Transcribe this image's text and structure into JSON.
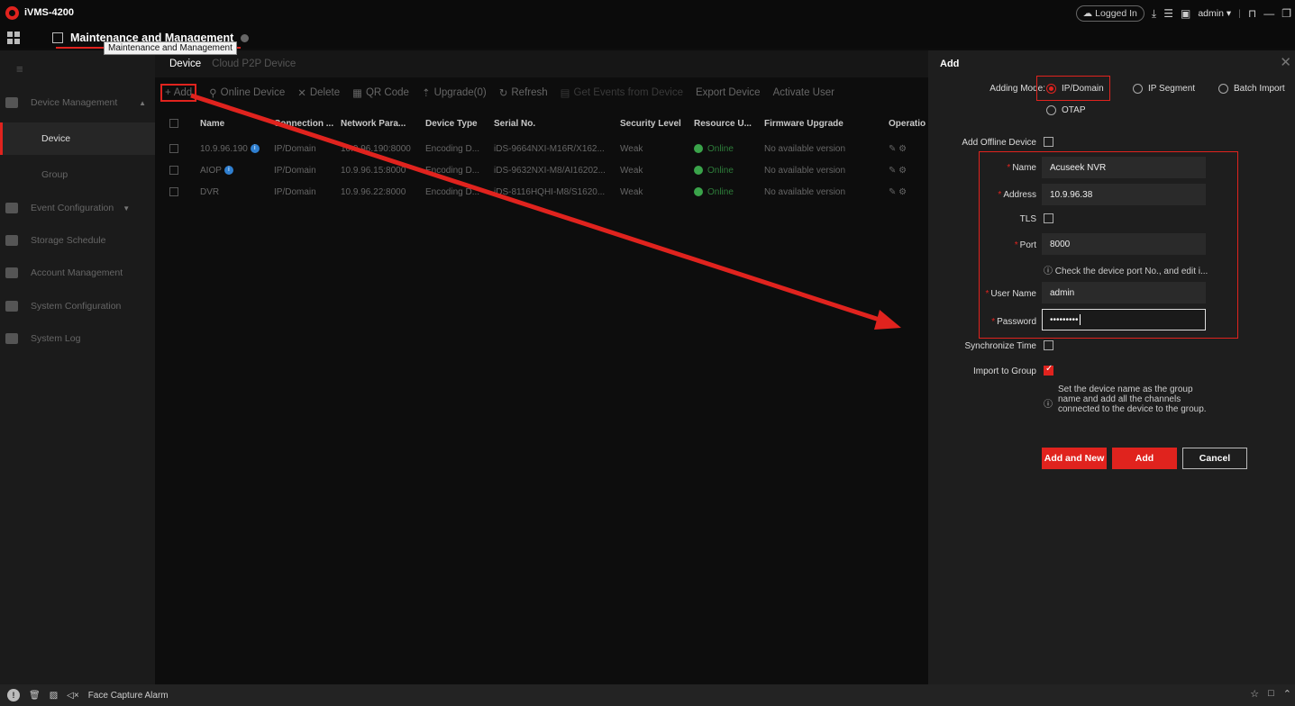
{
  "app": {
    "title": "iVMS-4200"
  },
  "titlebar": {
    "login_status": "Logged In",
    "user": "admin",
    "icons": [
      "cloud-icon",
      "download-icon",
      "list-icon",
      "image-icon",
      "lock-icon",
      "minimize-icon",
      "restore-icon",
      "close-icon"
    ]
  },
  "tabbar": {
    "tab_label": "Maintenance and Management",
    "tooltip": "Maintenance and Management"
  },
  "sidebar": {
    "items": [
      {
        "label": "Device Management",
        "icon": "device-management-icon"
      },
      {
        "label": "Device",
        "active": true
      },
      {
        "label": "Group"
      },
      {
        "label": "Event Configuration",
        "icon": "event-icon"
      },
      {
        "label": "Storage Schedule",
        "icon": "storage-icon"
      },
      {
        "label": "Account Management",
        "icon": "account-icon"
      },
      {
        "label": "System Configuration",
        "icon": "gear-icon"
      },
      {
        "label": "System Log",
        "icon": "log-icon"
      }
    ]
  },
  "main": {
    "tabs": [
      "Device",
      "Cloud P2P Device"
    ],
    "toolbar": {
      "add": "Add",
      "online_device": "Online Device",
      "delete": "Delete",
      "qr_code": "QR Code",
      "upgrade": "Upgrade(0)",
      "refresh": "Refresh",
      "get_events": "Get Events from Device",
      "export": "Export Device",
      "activate": "Activate User"
    },
    "columns": [
      "Name",
      "Connection ...",
      "Network Para...",
      "Device Type",
      "Serial No.",
      "Security Level",
      "Resource U...",
      "Firmware Upgrade",
      "Operatio"
    ],
    "rows": [
      {
        "name": "10.9.96.190",
        "info": true,
        "connection": "IP/Domain",
        "network": "10.9.96.190:8000",
        "type": "Encoding D...",
        "serial": "iDS-9664NXI-M16R/X162...",
        "security": "Weak",
        "resource": "Online",
        "firmware": "No available version"
      },
      {
        "name": "AIOP",
        "info": true,
        "connection": "IP/Domain",
        "network": "10.9.96.15:8000",
        "type": "Encoding D...",
        "serial": "iDS-9632NXI-M8/AI16202...",
        "security": "Weak",
        "resource": "Online",
        "firmware": "No available version"
      },
      {
        "name": "DVR",
        "info": false,
        "connection": "IP/Domain",
        "network": "10.9.96.22:8000",
        "type": "Encoding D...",
        "serial": "iDS-8116HQHI-M8/S1620...",
        "security": "Weak",
        "resource": "Online",
        "firmware": "No available version"
      }
    ]
  },
  "panel": {
    "title": "Add",
    "adding_mode_label": "Adding Mode:",
    "modes": [
      "IP/Domain",
      "IP Segment",
      "Batch Import",
      "OTAP"
    ],
    "offline_label": "Add Offline Device",
    "name_label": "Name",
    "name_value": "Acuseek NVR",
    "address_label": "Address",
    "address_value": "10.9.96.38",
    "tls_label": "TLS",
    "port_label": "Port",
    "port_value": "8000",
    "port_hint": "Check the device port No., and edit i...",
    "username_label": "User Name",
    "username_value": "admin",
    "password_label": "Password",
    "password_value": "•••••••••",
    "sync_label": "Synchronize Time",
    "import_label": "Import to Group",
    "import_hint_1": "Set the device name as the group",
    "import_hint_2": "name and add all the channels",
    "import_hint_3": "connected to the device to the group.",
    "btn_add_new": "Add and New",
    "btn_add": "Add",
    "btn_cancel": "Cancel"
  },
  "statusbar": {
    "alarm_text": "Face Capture Alarm"
  }
}
